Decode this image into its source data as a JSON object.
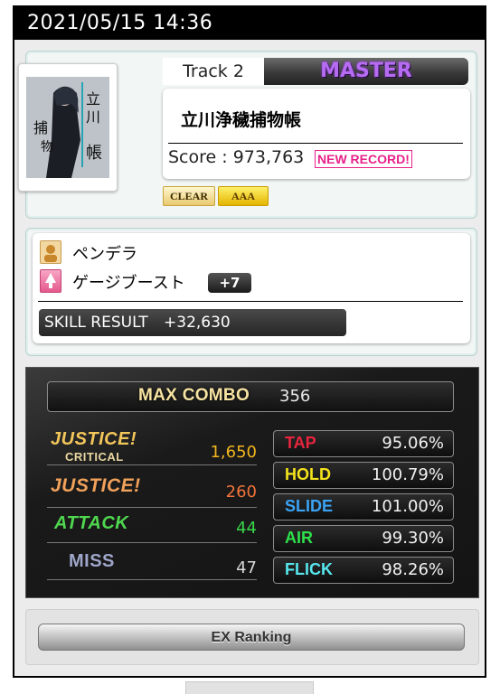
{
  "datetime": "2021/05/15 14:36",
  "song": {
    "track_label": "Track 2",
    "difficulty": "MASTER",
    "title": "立川浄穢捕物帳",
    "score_label": "Score : 973,763",
    "new_record": "NEW RECORD!",
    "badges": {
      "clear": "CLEAR",
      "rank": "AAA"
    }
  },
  "skill": {
    "character": "ペンデラ",
    "skill_name": "ゲージブースト",
    "skill_level": "+7",
    "result_label": "SKILL RESULT",
    "result_value": "+32,630"
  },
  "judge": {
    "max_combo_label": "MAX COMBO",
    "max_combo": "356",
    "justice_critical_label_1": "JUSTICE!",
    "justice_critical_label_2": "CRITICAL",
    "justice_critical": "1,650",
    "justice_label": "JUSTICE!",
    "justice": "260",
    "attack_label": "ATTACK",
    "attack": "44",
    "miss_label": "MISS",
    "miss": "47"
  },
  "rates": [
    {
      "label": "TAP",
      "value": "95.06%",
      "color": "#e8253d"
    },
    {
      "label": "HOLD",
      "value": "100.79%",
      "color": "#f4e21c"
    },
    {
      "label": "SLIDE",
      "value": "101.00%",
      "color": "#3aa3f5"
    },
    {
      "label": "AIR",
      "value": "99.30%",
      "color": "#2fe04a"
    },
    {
      "label": "FLICK",
      "value": "98.26%",
      "color": "#56e7ee"
    }
  ],
  "ex_ranking_label": "EX Ranking"
}
